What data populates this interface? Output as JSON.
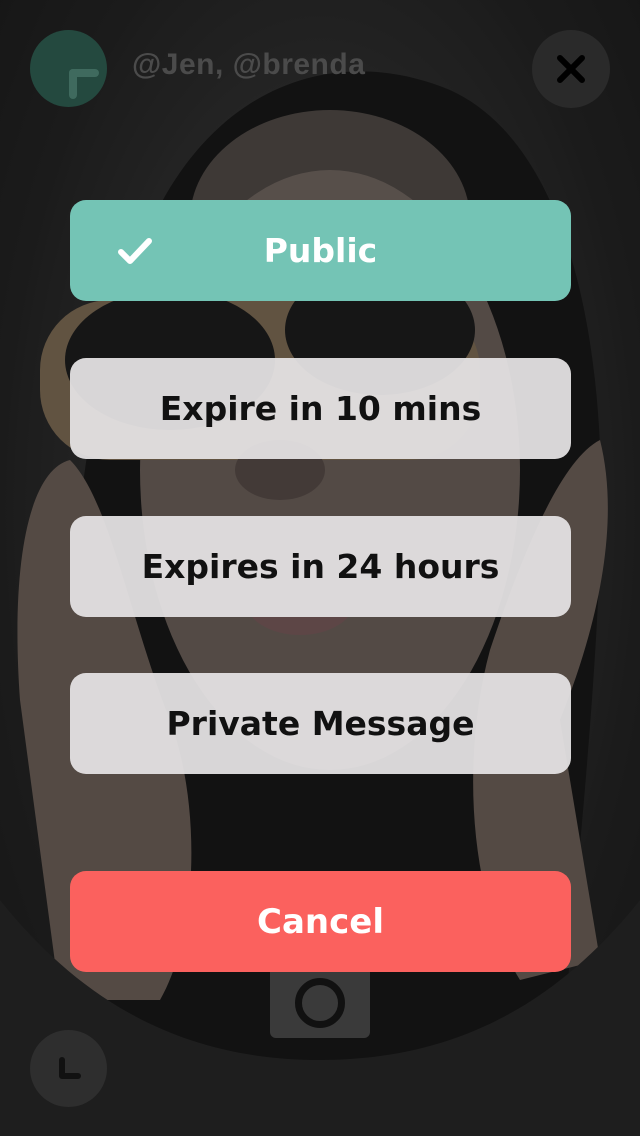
{
  "header": {
    "recipients_text": "@Jen, @brenda",
    "add_icon": "plus-icon",
    "close_icon": "close-icon"
  },
  "options": [
    {
      "label": "Public",
      "selected": true,
      "icon": "checkmark-icon"
    },
    {
      "label": "Expire in 10 mins",
      "selected": false
    },
    {
      "label": "Expires in 24 hours",
      "selected": false
    },
    {
      "label": "Private Message",
      "selected": false
    }
  ],
  "cancel_label": "Cancel",
  "footer": {
    "shutter_icon": "camera-shutter-icon",
    "timer_icon": "clock-icon"
  },
  "colors": {
    "selected": "#74c4b5",
    "option_bg": "#e4e2e3",
    "cancel": "#fb615e",
    "add_button": "#24493f"
  }
}
